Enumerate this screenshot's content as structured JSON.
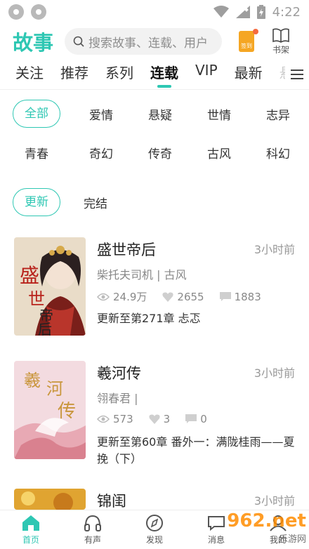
{
  "status_bar": {
    "time": "4:22"
  },
  "header": {
    "logo": "故事",
    "search_placeholder": "搜索故事、连载、用户",
    "signin_label": "签到",
    "shelf_label": "书架"
  },
  "tabs": [
    {
      "label": "关注"
    },
    {
      "label": "推荐"
    },
    {
      "label": "系列"
    },
    {
      "label": "连载",
      "active": true
    },
    {
      "label": "VIP"
    },
    {
      "label": "最新"
    },
    {
      "label": "悬"
    }
  ],
  "genres": {
    "row1": [
      "全部",
      "爱情",
      "悬疑",
      "世情",
      "志异"
    ],
    "row2": [
      "青春",
      "奇幻",
      "传奇",
      "古风",
      "科幻"
    ]
  },
  "status_filters": [
    "更新",
    "完结"
  ],
  "books": [
    {
      "title": "盛世帝后",
      "time": "3小时前",
      "author": "柴托夫司机 | 古风",
      "views": "24.9万",
      "likes": "2655",
      "comments": "1883",
      "latest": "更新至第271章 忐忑",
      "cover_text": "盛世帝后"
    },
    {
      "title": "羲河传",
      "time": "3小时前",
      "author": "翎春君 |",
      "views": "573",
      "likes": "3",
      "comments": "0",
      "latest": "更新至第60章 番外一：满陇桂雨——夏挽（下）",
      "cover_text": "羲河传"
    },
    {
      "title": "锦闺",
      "time": "3小时前"
    }
  ],
  "bottom_nav": [
    {
      "label": "首页",
      "icon": "home-icon",
      "active": true
    },
    {
      "label": "有声",
      "icon": "headphones-icon"
    },
    {
      "label": "发现",
      "icon": "compass-icon"
    },
    {
      "label": "消息",
      "icon": "message-icon"
    },
    {
      "label": "我的",
      "icon": "user-icon"
    }
  ],
  "watermark": {
    "brand": "962.net",
    "sub": "乐游网"
  },
  "colors": {
    "accent": "#2ec7b3",
    "signin": "#f5a623"
  }
}
